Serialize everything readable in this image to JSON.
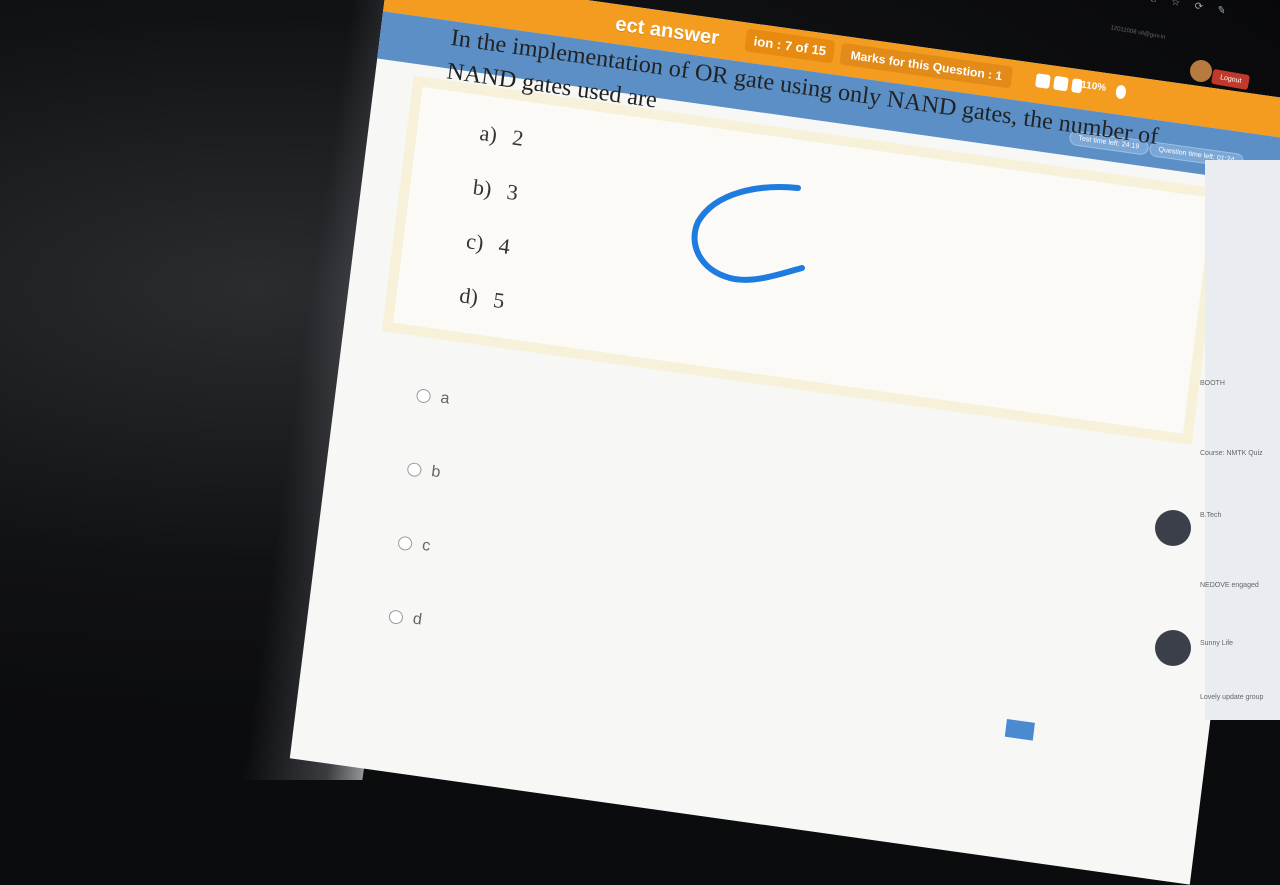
{
  "header": {
    "section_title": "ect answer",
    "question_counter": "ion : 7 of 15",
    "marks_label": "Marks for this Question : 1",
    "zoom_level": "110%",
    "user_id": "12011008 vit@gov.in",
    "logout_label": "Logout"
  },
  "timers": {
    "test_time_left": "Test time left: 24:19",
    "question_time_left": "Question time left: 01:24"
  },
  "question": {
    "text": "In the implementation of OR gate using only NAND gates, the number of NAND gates used are",
    "options": [
      {
        "label": "a)",
        "value": "2"
      },
      {
        "label": "b)",
        "value": "3"
      },
      {
        "label": "c)",
        "value": "4"
      },
      {
        "label": "d)",
        "value": "5"
      }
    ]
  },
  "answers": [
    {
      "label": "a"
    },
    {
      "label": "b"
    },
    {
      "label": "c"
    },
    {
      "label": "d"
    }
  ],
  "handwritten_mark": "C",
  "colors": {
    "orange_bar": "#f39c1f",
    "blue_bar": "#5b8fc6",
    "question_bg": "#fbfaf6",
    "ink": "#1e7be0"
  },
  "sidebar": {
    "items": [
      {
        "name": "BOOTH"
      },
      {
        "name": "Course: NMTK Quiz"
      },
      {
        "name": "B.Tech"
      },
      {
        "name": "NEDOVE engaged"
      },
      {
        "name": "Sunny Life"
      },
      {
        "name": "Lovely update group"
      }
    ]
  }
}
